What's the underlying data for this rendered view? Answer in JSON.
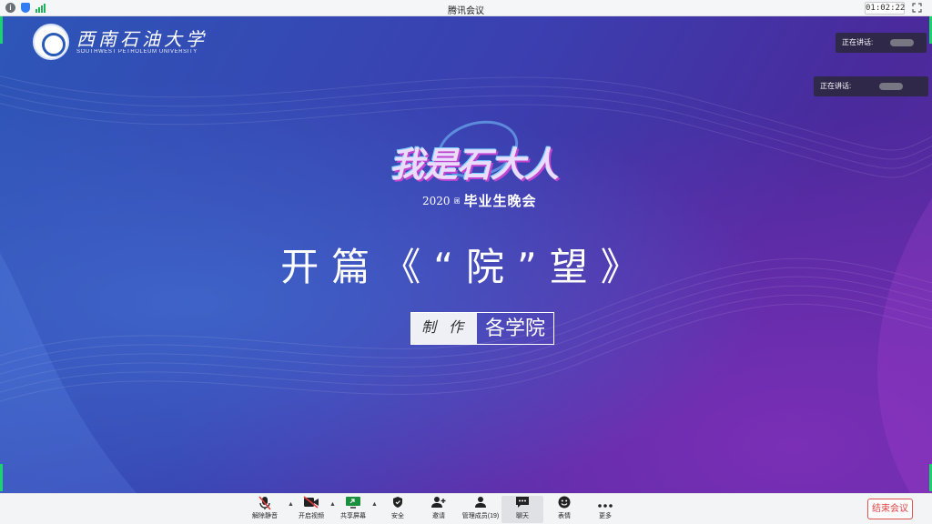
{
  "window": {
    "title": "腾讯会议",
    "timer": "01:02:22"
  },
  "stage": {
    "university": {
      "name_cn": "西南石油大学",
      "name_en": "SOUTHWEST PETROLEUM UNIVERSITY"
    },
    "speaking": [
      {
        "label": "正在讲话:"
      },
      {
        "label": "正在讲话:"
      }
    ],
    "event": {
      "main_title": "我是石大人",
      "year": "2020",
      "edition": "届",
      "name": "毕业生晚会"
    },
    "headline": "开篇《“院”望》",
    "credit": {
      "label": "制作",
      "value": "各学院"
    }
  },
  "toolbar": {
    "items": [
      {
        "label": "解除静音",
        "icon": "mic-muted-icon"
      },
      {
        "label": "开启视频",
        "icon": "camera-off-icon"
      },
      {
        "label": "共享屏幕",
        "icon": "screen-share-icon"
      },
      {
        "label": "安全",
        "icon": "shield-icon"
      },
      {
        "label": "邀请",
        "icon": "invite-icon"
      },
      {
        "label": "管理成员(19)",
        "icon": "members-icon"
      },
      {
        "label": "聊天",
        "icon": "chat-icon"
      },
      {
        "label": "表情",
        "icon": "emoji-icon"
      },
      {
        "label": "更多",
        "icon": "more-icon"
      }
    ],
    "end_label": "结束会议"
  },
  "colors": {
    "accent_green": "#1bd36c",
    "end_red": "#e34040"
  }
}
